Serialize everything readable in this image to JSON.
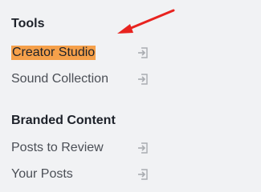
{
  "tools": {
    "heading": "Tools",
    "items": [
      {
        "label": "Creator Studio",
        "highlighted": true,
        "icon": "open-external-icon"
      },
      {
        "label": "Sound Collection",
        "highlighted": false,
        "icon": "open-external-icon"
      }
    ]
  },
  "branded_content": {
    "heading": "Branded Content",
    "items": [
      {
        "label": "Posts to Review",
        "icon": "open-external-icon"
      },
      {
        "label": "Your Posts",
        "icon": "open-external-icon"
      }
    ]
  },
  "colors": {
    "background": "#f1f2f4",
    "highlight": "#f5a04a",
    "annotation_arrow": "#e8231f"
  }
}
